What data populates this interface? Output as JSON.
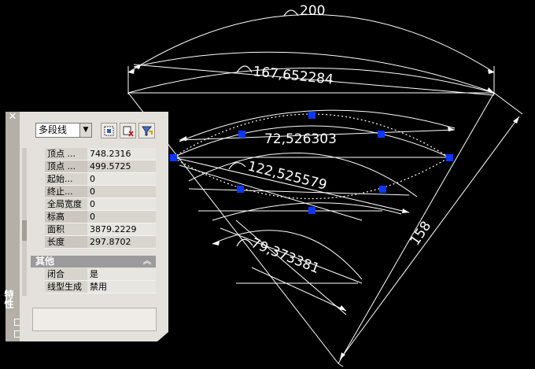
{
  "drawing": {
    "dimensions": {
      "arc_top": "200",
      "arc_upper": "167,652284",
      "arc_middle": "72,526303",
      "arc_lower_left": "122,525579",
      "arc_lower": "79,373381",
      "aligned_side": "158"
    }
  },
  "palette": {
    "title": "特性",
    "close_icon": "close-icon",
    "object_type": "多段线",
    "toolbar_icons": [
      "quick-select-icon",
      "select-objects-icon",
      "toggle-pickadd-icon"
    ],
    "properties": [
      {
        "label": "顶点 ...",
        "value": "748.2316"
      },
      {
        "label": "顶点 ...",
        "value": "499.5725"
      },
      {
        "label": "起始...",
        "value": "0"
      },
      {
        "label": "终止...",
        "value": "0"
      },
      {
        "label": "全局宽度",
        "value": "0"
      },
      {
        "label": "标高",
        "value": "0"
      },
      {
        "label": "面积",
        "value": "3879.2229"
      },
      {
        "label": "长度",
        "value": "297.8702"
      }
    ],
    "misc_section": {
      "title": "其他",
      "rows": [
        {
          "label": "闭合",
          "value": "是"
        },
        {
          "label": "线型生成",
          "value": "禁用"
        }
      ]
    }
  },
  "colors": {
    "background": "#000000",
    "lines": "#ffffff",
    "grips": "#0a37ff"
  }
}
